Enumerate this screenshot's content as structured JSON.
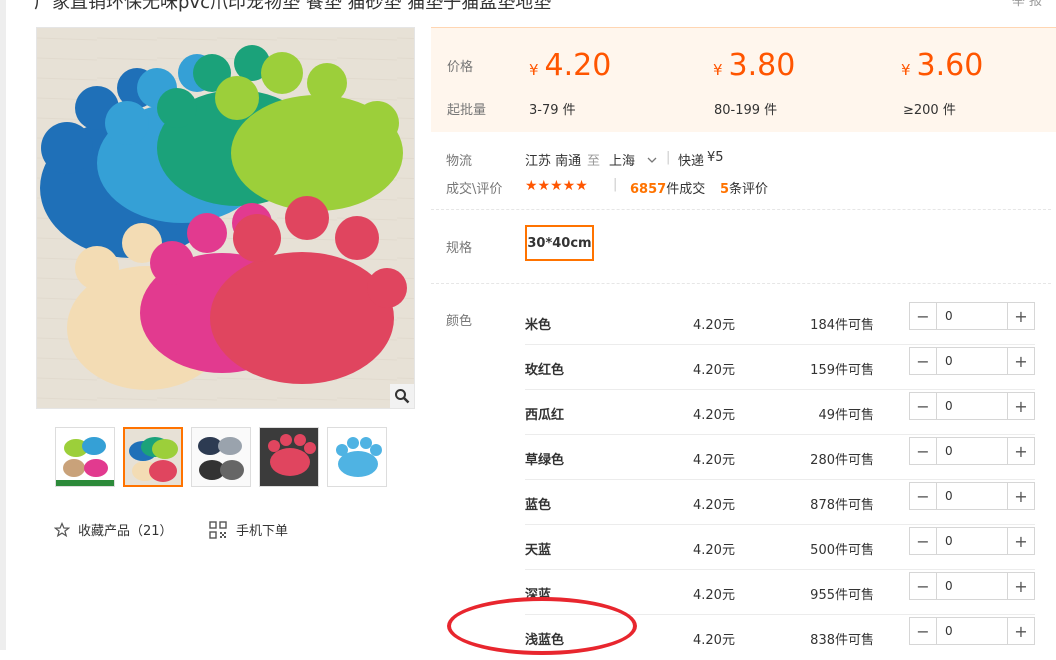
{
  "product": {
    "title": "厂家直销环保无味pvc爪印宠物垫 餐垫 猫砂垫 猫垫子猫盆垫地垫",
    "top_right_tool": "举 报"
  },
  "gallery": {
    "favorite_label": "收藏产品（21）",
    "mobile_order_label": "手机下单"
  },
  "price": {
    "price_label": "价格",
    "moq_label": "起批量",
    "currency": "¥",
    "tiers": [
      {
        "price": "4.20",
        "range": "3-79 件"
      },
      {
        "price": "3.80",
        "range": "80-199 件"
      },
      {
        "price": "3.60",
        "range": "≥200 件"
      }
    ]
  },
  "logistics": {
    "label": "物流",
    "from": "江苏 南通",
    "to_word": "至",
    "dest": "上海",
    "method": "快递",
    "fee": "¥5"
  },
  "reviews": {
    "label": "成交\\评价",
    "stars": "★★★★★",
    "deals_count": "6857",
    "deals_suffix": "件成交",
    "review_count": "5",
    "review_suffix": "条评价"
  },
  "spec": {
    "label": "规格",
    "selected": "30*40cm"
  },
  "colors": {
    "label": "颜色",
    "rows": [
      {
        "name": "米色",
        "price": "4.20元",
        "stock": "184件可售",
        "qty": "0"
      },
      {
        "name": "玫红色",
        "price": "4.20元",
        "stock": "159件可售",
        "qty": "0"
      },
      {
        "name": "西瓜红",
        "price": "4.20元",
        "stock": "49件可售",
        "qty": "0"
      },
      {
        "name": "草绿色",
        "price": "4.20元",
        "stock": "280件可售",
        "qty": "0"
      },
      {
        "name": "蓝色",
        "price": "4.20元",
        "stock": "878件可售",
        "qty": "0"
      },
      {
        "name": "天蓝",
        "price": "4.20元",
        "stock": "500件可售",
        "qty": "0"
      },
      {
        "name": "深蓝",
        "price": "4.20元",
        "stock": "955件可售",
        "qty": "0"
      },
      {
        "name": "浅蓝色",
        "price": "4.20元",
        "stock": "838件可售",
        "qty": "0"
      }
    ]
  },
  "theme": {
    "accent": "#ff7300",
    "price_color": "#ff5500",
    "annotation_color": "#e8262e"
  }
}
